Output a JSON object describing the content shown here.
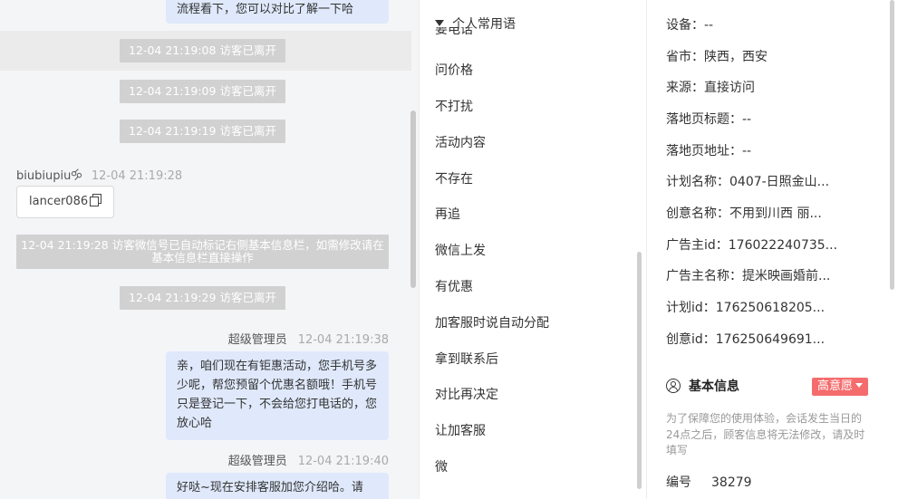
{
  "chat": {
    "top_clipped_bubble": "流程看下，您可以对比了解一下哈",
    "system_left_1": "12-04 21:19:08 访客已离开",
    "system_left_2": "12-04 21:19:09 访客已离开",
    "system_left_3": "12-04 21:19:19 访客已离开",
    "visitor_name": "biubiupiu🝰",
    "visitor_time": "12-04 21:19:28",
    "visitor_message": "lancer086",
    "system_wechat_note": "12-04 21:19:28 访客微信号已自动标记右侧基本信息栏，如需修改请在基本信息栏直接操作",
    "system_left_4": "12-04 21:19:29 访客已离开",
    "agent_name_1": "超级管理员",
    "agent_time_1": "12-04 21:19:38",
    "agent_message_1": "亲，咱们现在有钜惠活动，您手机号多少呢，帮您预留个优惠名额哦！手机号只是登记一下，不会给您打电话的，您放心哈",
    "agent_name_2": "超级管理员",
    "agent_time_2": "12-04 21:19:40",
    "agent_message_2": "好哒~现在安排客服加您介绍哈。请"
  },
  "phrases": {
    "header": "个人常用语",
    "clipped_item": "要电话",
    "items": [
      "问价格",
      "不打扰",
      "活动内容",
      "不存在",
      "再追",
      "微信上发",
      "有优惠",
      "加客服时说自动分配",
      "拿到联系后",
      "对比再决定",
      "让加客服",
      "微"
    ]
  },
  "info": {
    "rows": [
      "设备：--",
      "省市：陕西，西安",
      "来源：直接访问",
      "落地页标题：--",
      "落地页地址：--",
      "计划名称：0407-日照金山...",
      "创意名称：不用到川西 丽...",
      "广告主id：176022240735...",
      "广告主名称：提米映画婚前...",
      "计划id：176250618205...",
      "创意id：176250649691..."
    ],
    "section_title": "基本信息",
    "intent_label": "高意愿",
    "notice": "为了保障您的使用体验，会话发生当日的24点之后，顾客信息将无法修改，请及时填写",
    "id_label": "编号",
    "id_value": "38279"
  }
}
